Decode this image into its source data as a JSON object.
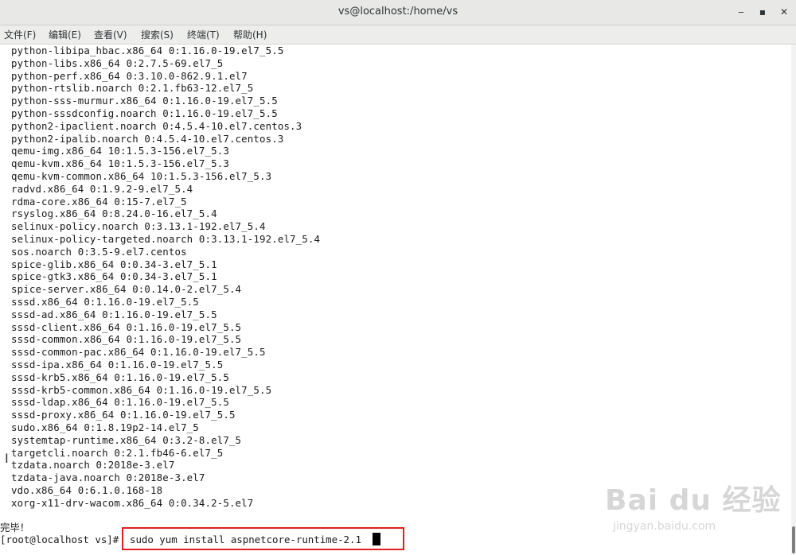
{
  "window": {
    "title": "vs@localhost:/home/vs",
    "minimize_label": "‒",
    "maximize_label": "▪",
    "close_label": "✕"
  },
  "menu": [
    "文件(F)",
    "编辑(E)",
    "查看(V)",
    "搜索(S)",
    "终端(T)",
    "帮助(H)"
  ],
  "terminal": {
    "lines": [
      "python-libipa_hbac.x86_64 0:1.16.0-19.el7_5.5",
      "python-libs.x86_64 0:2.7.5-69.el7_5",
      "python-perf.x86_64 0:3.10.0-862.9.1.el7",
      "python-rtslib.noarch 0:2.1.fb63-12.el7_5",
      "python-sss-murmur.x86_64 0:1.16.0-19.el7_5.5",
      "python-sssdconfig.noarch 0:1.16.0-19.el7_5.5",
      "python2-ipaclient.noarch 0:4.5.4-10.el7.centos.3",
      "python2-ipalib.noarch 0:4.5.4-10.el7.centos.3",
      "qemu-img.x86_64 10:1.5.3-156.el7_5.3",
      "qemu-kvm.x86_64 10:1.5.3-156.el7_5.3",
      "qemu-kvm-common.x86_64 10:1.5.3-156.el7_5.3",
      "radvd.x86_64 0:1.9.2-9.el7_5.4",
      "rdma-core.x86_64 0:15-7.el7_5",
      "rsyslog.x86_64 0:8.24.0-16.el7_5.4",
      "selinux-policy.noarch 0:3.13.1-192.el7_5.4",
      "selinux-policy-targeted.noarch 0:3.13.1-192.el7_5.4",
      "sos.noarch 0:3.5-9.el7.centos",
      "spice-glib.x86_64 0:0.34-3.el7_5.1",
      "spice-gtk3.x86_64 0:0.34-3.el7_5.1",
      "spice-server.x86_64 0:0.14.0-2.el7_5.4",
      "sssd.x86_64 0:1.16.0-19.el7_5.5",
      "sssd-ad.x86_64 0:1.16.0-19.el7_5.5",
      "sssd-client.x86_64 0:1.16.0-19.el7_5.5",
      "sssd-common.x86_64 0:1.16.0-19.el7_5.5",
      "sssd-common-pac.x86_64 0:1.16.0-19.el7_5.5",
      "sssd-ipa.x86_64 0:1.16.0-19.el7_5.5",
      "sssd-krb5.x86_64 0:1.16.0-19.el7_5.5",
      "sssd-krb5-common.x86_64 0:1.16.0-19.el7_5.5",
      "sssd-ldap.x86_64 0:1.16.0-19.el7_5.5",
      "sssd-proxy.x86_64 0:1.16.0-19.el7_5.5",
      "sudo.x86_64 0:1.8.19p2-14.el7_5",
      "systemtap-runtime.x86_64 0:3.2-8.el7_5",
      "targetcli.noarch 0:2.1.fb46-6.el7_5",
      "tzdata.noarch 0:2018e-3.el7",
      "tzdata-java.noarch 0:2018e-3.el7",
      "vdo.x86_64 0:6.1.0.168-18",
      "xorg-x11-drv-wacom.x86_64 0:0.34.2-5.el7"
    ],
    "done_text": "完毕！",
    "prompt": "[root@localhost vs]#",
    "command": "sudo yum install aspnetcore-runtime-2.1"
  },
  "watermark": {
    "logo": "Bai du 经验",
    "url": "jingyan.baidu.com"
  }
}
